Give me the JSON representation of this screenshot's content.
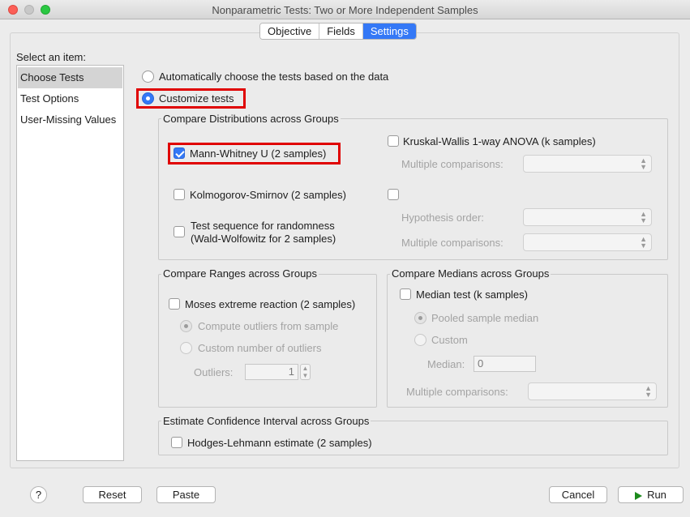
{
  "window": {
    "title": "Nonparametric Tests: Two or More Independent Samples"
  },
  "tabs": [
    {
      "label": "Objective"
    },
    {
      "label": "Fields"
    },
    {
      "label": "Settings"
    }
  ],
  "sidebar": {
    "label": "Select an item:",
    "items": [
      {
        "label": "Choose Tests"
      },
      {
        "label": "Test Options"
      },
      {
        "label": "User-Missing Values"
      }
    ]
  },
  "mode": {
    "auto_label": "Automatically choose the tests based on the data",
    "custom_label": "Customize tests"
  },
  "distributions": {
    "legend": "Compare Distributions across Groups",
    "mann_whitney": "Mann-Whitney U (2 samples)",
    "kolmogorov": "Kolmogorov-Smirnov (2 samples)",
    "randomness_line1": "Test sequence for randomness",
    "randomness_line2": "(Wald-Wolfowitz for 2 samples)",
    "kruskal": "Kruskal-Wallis 1-way ANOVA (k samples)",
    "multiple_comparisons": "Multiple comparisons:",
    "hypothesis_order": "Hypothesis order:",
    "multiple_comparisons_2": "Multiple comparisons:"
  },
  "ranges": {
    "legend": "Compare Ranges across Groups",
    "moses": "Moses extreme reaction (2 samples)",
    "compute_outliers": "Compute outliers from sample",
    "custom_outliers": "Custom number of outliers",
    "outliers_label": "Outliers:",
    "outliers_value": "1"
  },
  "medians": {
    "legend": "Compare Medians across Groups",
    "median_test": "Median test (k samples)",
    "pooled": "Pooled sample median",
    "custom": "Custom",
    "median_label": "Median:",
    "median_value": "0",
    "multiple_comparisons": "Multiple comparisons:"
  },
  "confidence": {
    "legend": "Estimate Confidence Interval across Groups",
    "hodges": "Hodges-Lehmann estimate (2 samples)"
  },
  "buttons": {
    "help": "?",
    "reset": "Reset",
    "paste": "Paste",
    "cancel": "Cancel",
    "run": "Run"
  },
  "colors": {
    "accent": "#3478f6",
    "highlight": "#e00000",
    "run_icon": "#1c8a1c"
  }
}
